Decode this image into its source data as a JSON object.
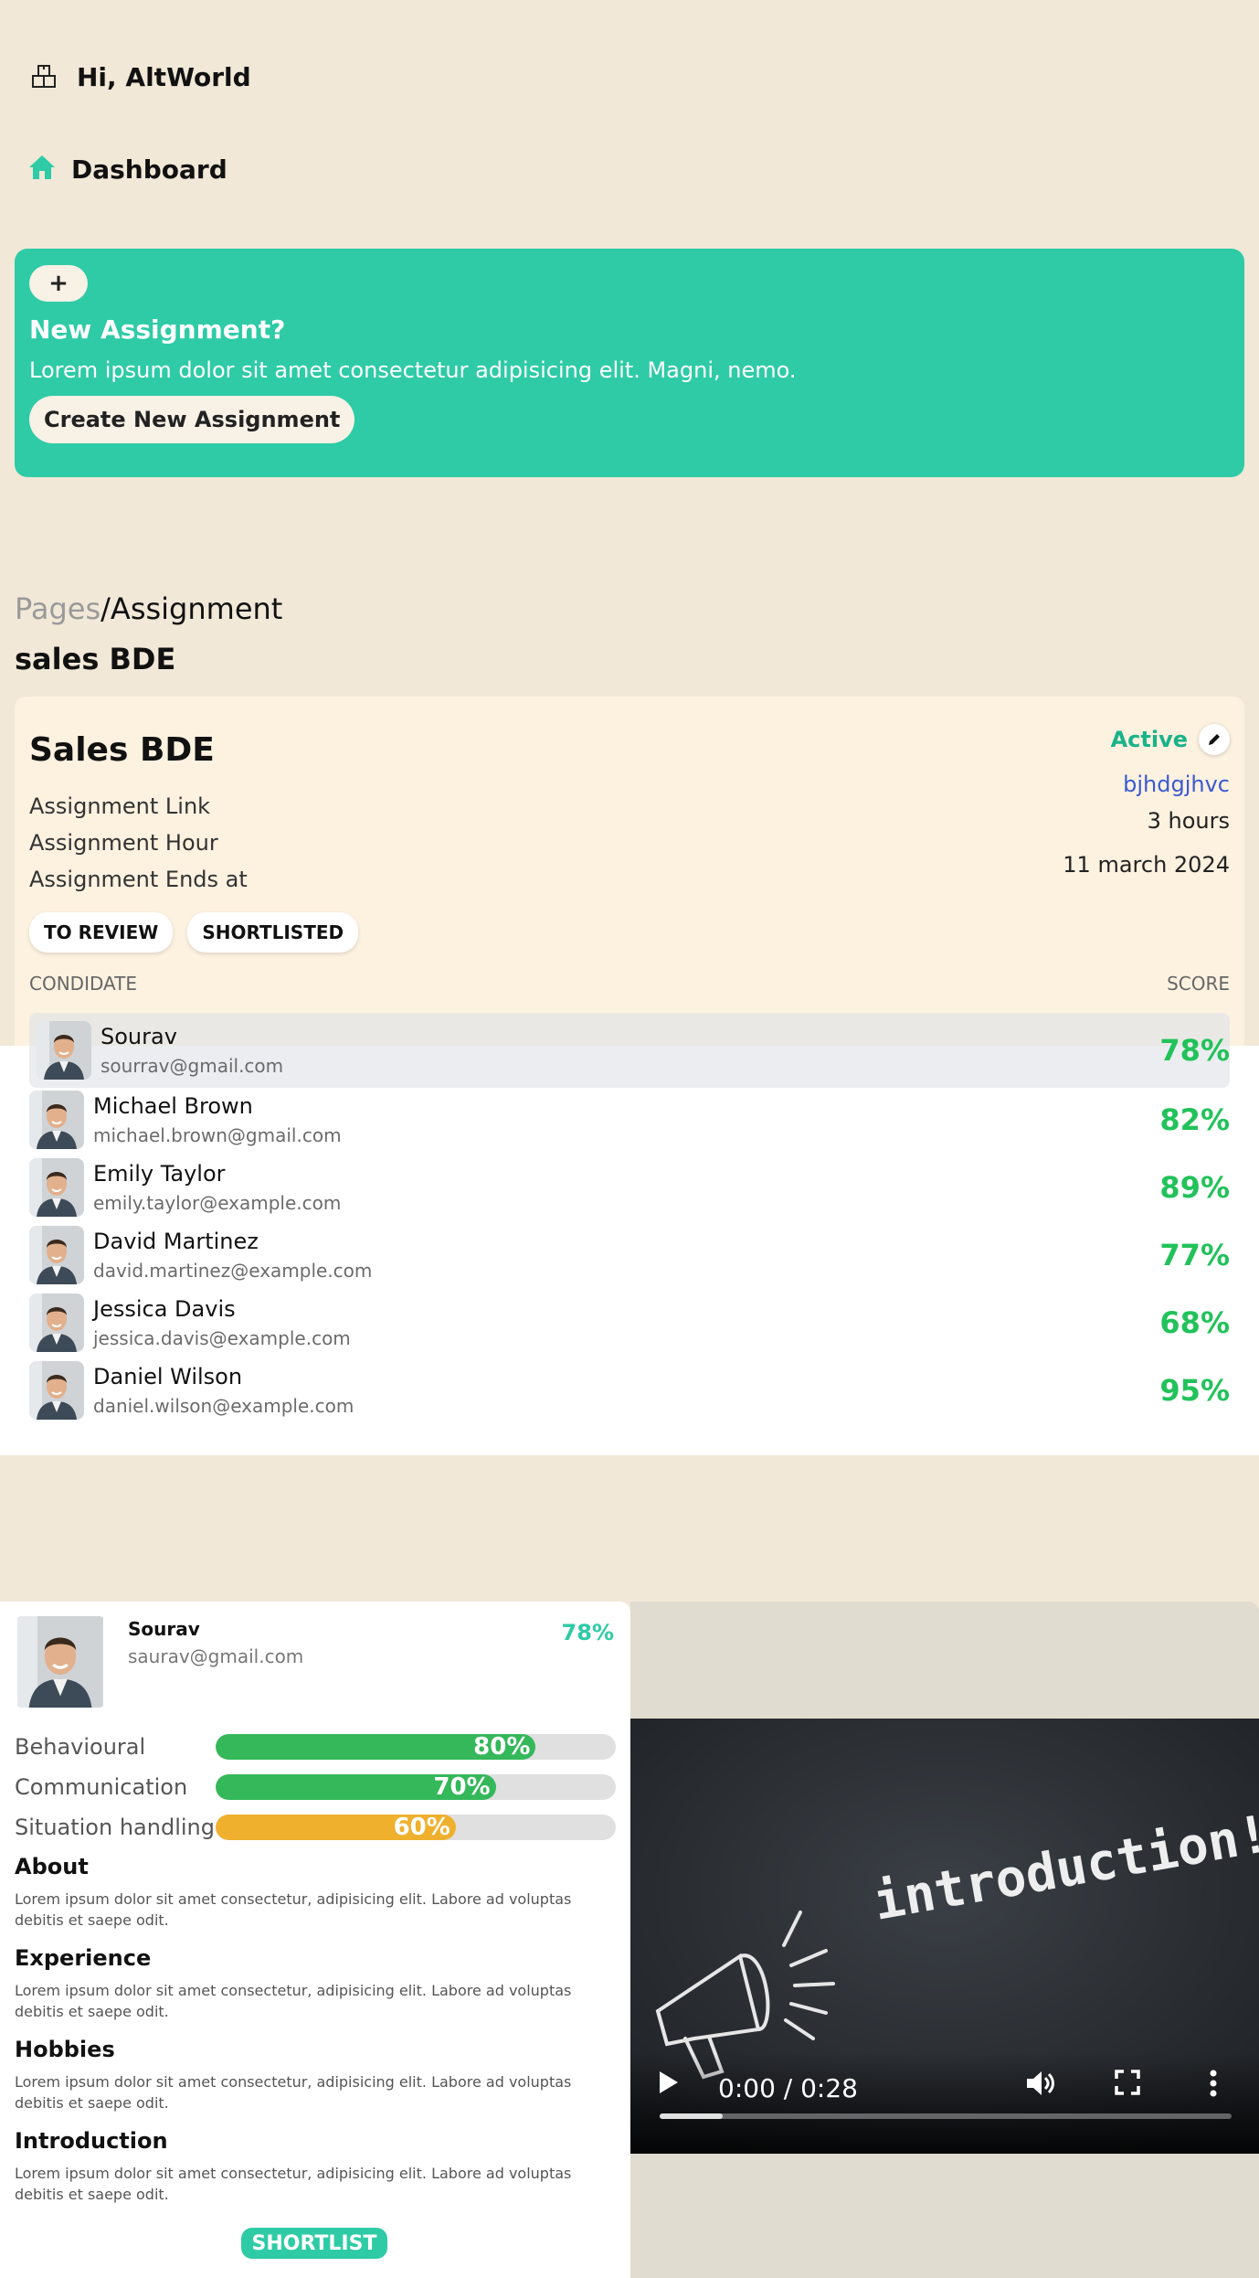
{
  "header": {
    "greeting": "Hi, AltWorld",
    "nav_dashboard": "Dashboard"
  },
  "promo": {
    "plus": "+",
    "title": "New Assignment?",
    "desc": "Lorem ipsum dolor sit amet consectetur adipisicing elit. Magni, nemo.",
    "button": "Create New Assignment"
  },
  "breadcrumb": {
    "root": "Pages",
    "current": "/Assignment"
  },
  "page_title": "sales BDE",
  "assignment": {
    "title": "Sales BDE",
    "status": "Active",
    "labels": {
      "link": "Assignment Link",
      "hour": "Assignment Hour",
      "ends": "Assignment Ends at"
    },
    "values": {
      "link": "bjhdgjhvc",
      "hour": "3 hours",
      "ends": "11 march 2024"
    },
    "tabs": [
      "TO REVIEW",
      "SHORTLISTED"
    ],
    "columns": {
      "candidate": "CONDIDATE",
      "score": "SCORE"
    },
    "candidates": [
      {
        "name": "Sourav",
        "email": "sourrav@gmail.com",
        "score": "78%"
      },
      {
        "name": "Michael Brown",
        "email": "michael.brown@gmail.com",
        "score": "82%"
      },
      {
        "name": "Emily Taylor",
        "email": "emily.taylor@example.com",
        "score": "89%"
      },
      {
        "name": "David Martinez",
        "email": "david.martinez@example.com",
        "score": "77%"
      },
      {
        "name": "Jessica Davis",
        "email": "jessica.davis@example.com",
        "score": "68%"
      },
      {
        "name": "Daniel Wilson",
        "email": "daniel.wilson@example.com",
        "score": "95%"
      }
    ]
  },
  "profile": {
    "name": "Sourav",
    "email": "saurav@gmail.com",
    "score": "78%",
    "skills": [
      {
        "label": "Behavioural",
        "value": "80%",
        "level": 0.8,
        "color": "#34b85a"
      },
      {
        "label": "Communication",
        "value": "70%",
        "level": 0.7,
        "color": "#34b85a"
      },
      {
        "label": "Situation handling",
        "value": "60%",
        "level": 0.6,
        "color": "#efb02d"
      }
    ],
    "sections": [
      {
        "heading": "About",
        "text": "Lorem ipsum dolor sit amet consectetur, adipisicing elit. Labore ad voluptas debitis et saepe odit."
      },
      {
        "heading": "Experience",
        "text": "Lorem ipsum dolor sit amet consectetur, adipisicing elit. Labore ad voluptas debitis et saepe odit."
      },
      {
        "heading": "Hobbies",
        "text": "Lorem ipsum dolor sit amet consectetur, adipisicing elit. Labore ad voluptas debitis et saepe odit."
      },
      {
        "heading": "Introduction",
        "text": "Lorem ipsum dolor sit amet consectetur, adipisicing elit. Labore ad voluptas debitis et saepe odit."
      }
    ],
    "shortlist_button": "SHORTLIST"
  },
  "video": {
    "time": "0:00 / 0:28",
    "caption": "introduction!",
    "progress": 0.11
  },
  "colors": {
    "accent": "#2ecba6",
    "score_green": "#22c25a",
    "beige": "#f1e8d8",
    "card": "#fdf1e0"
  },
  "icons": {
    "logo": "cube-boxes-icon",
    "home": "home-icon",
    "edit": "pencil-icon",
    "play": "play-icon",
    "volume": "volume-icon",
    "fullscreen": "fullscreen-icon",
    "more": "more-vertical-icon",
    "megaphone": "megaphone-icon"
  }
}
